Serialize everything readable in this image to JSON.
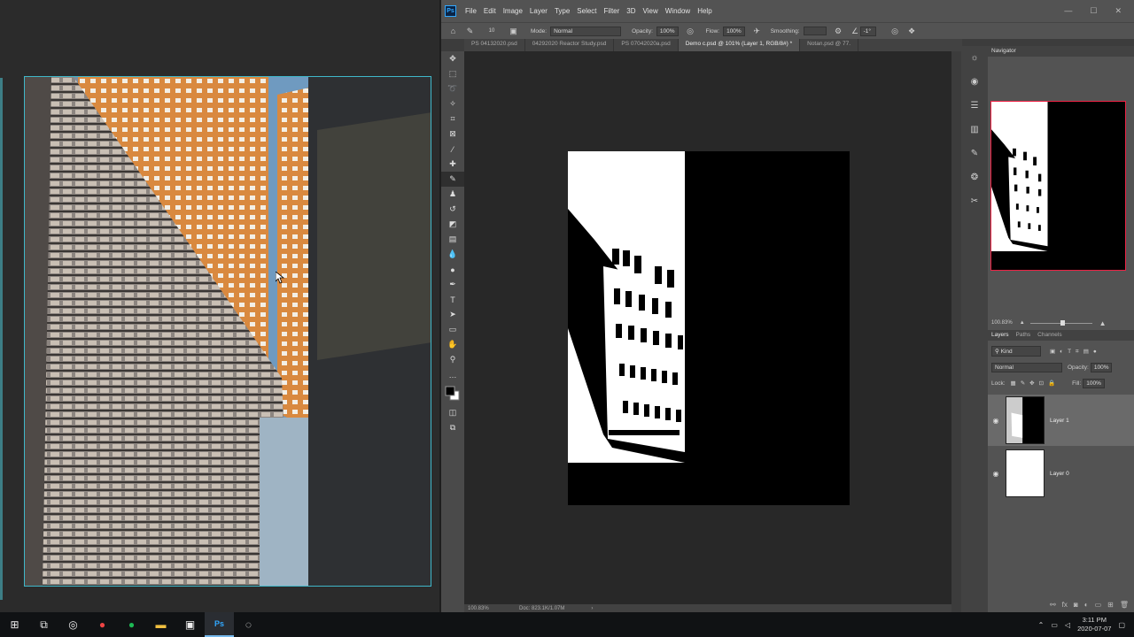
{
  "menubar": {
    "app_logo": "Ps",
    "items": [
      "File",
      "Edit",
      "Image",
      "Layer",
      "Type",
      "Select",
      "Filter",
      "3D",
      "View",
      "Window",
      "Help"
    ],
    "window_buttons": [
      "—",
      "☐",
      "✕"
    ]
  },
  "options": {
    "brush_size": "10",
    "mode_label": "Mode:",
    "mode_value": "Normal",
    "opacity_label": "Opacity:",
    "opacity_value": "100%",
    "flow_label": "Flow:",
    "flow_value": "100%",
    "smoothing_label": "Smoothing:",
    "angle_value": "-1°"
  },
  "tabs": [
    {
      "label": "PS 04132020.psd",
      "active": false
    },
    {
      "label": "04292020 Reactor Study.psd",
      "active": false
    },
    {
      "label": "PS 07042020a.psd",
      "active": false
    },
    {
      "label": "Demo c.psd @ 101% (Layer 1, RGB/8#) *",
      "active": true
    },
    {
      "label": "Notan.psd @ 77.",
      "active": false
    }
  ],
  "status": {
    "zoom": "100.83%",
    "doc_info": "Doc: 823.1K/1.07M"
  },
  "navigator": {
    "title": "Navigator",
    "zoom": "100.83%"
  },
  "layers_panel": {
    "tabs": [
      "Layers",
      "Paths",
      "Channels"
    ],
    "filter_label": "Kind",
    "blend_mode": "Normal",
    "opacity_label": "Opacity:",
    "opacity_value": "100%",
    "lock_label": "Lock:",
    "fill_label": "Fill:",
    "fill_value": "100%",
    "layers": [
      {
        "name": "Layer 1",
        "selected": true
      },
      {
        "name": "Layer 0",
        "selected": false
      }
    ]
  },
  "taskbar": {
    "time": "3:11 PM",
    "date": "2020-07-07"
  }
}
